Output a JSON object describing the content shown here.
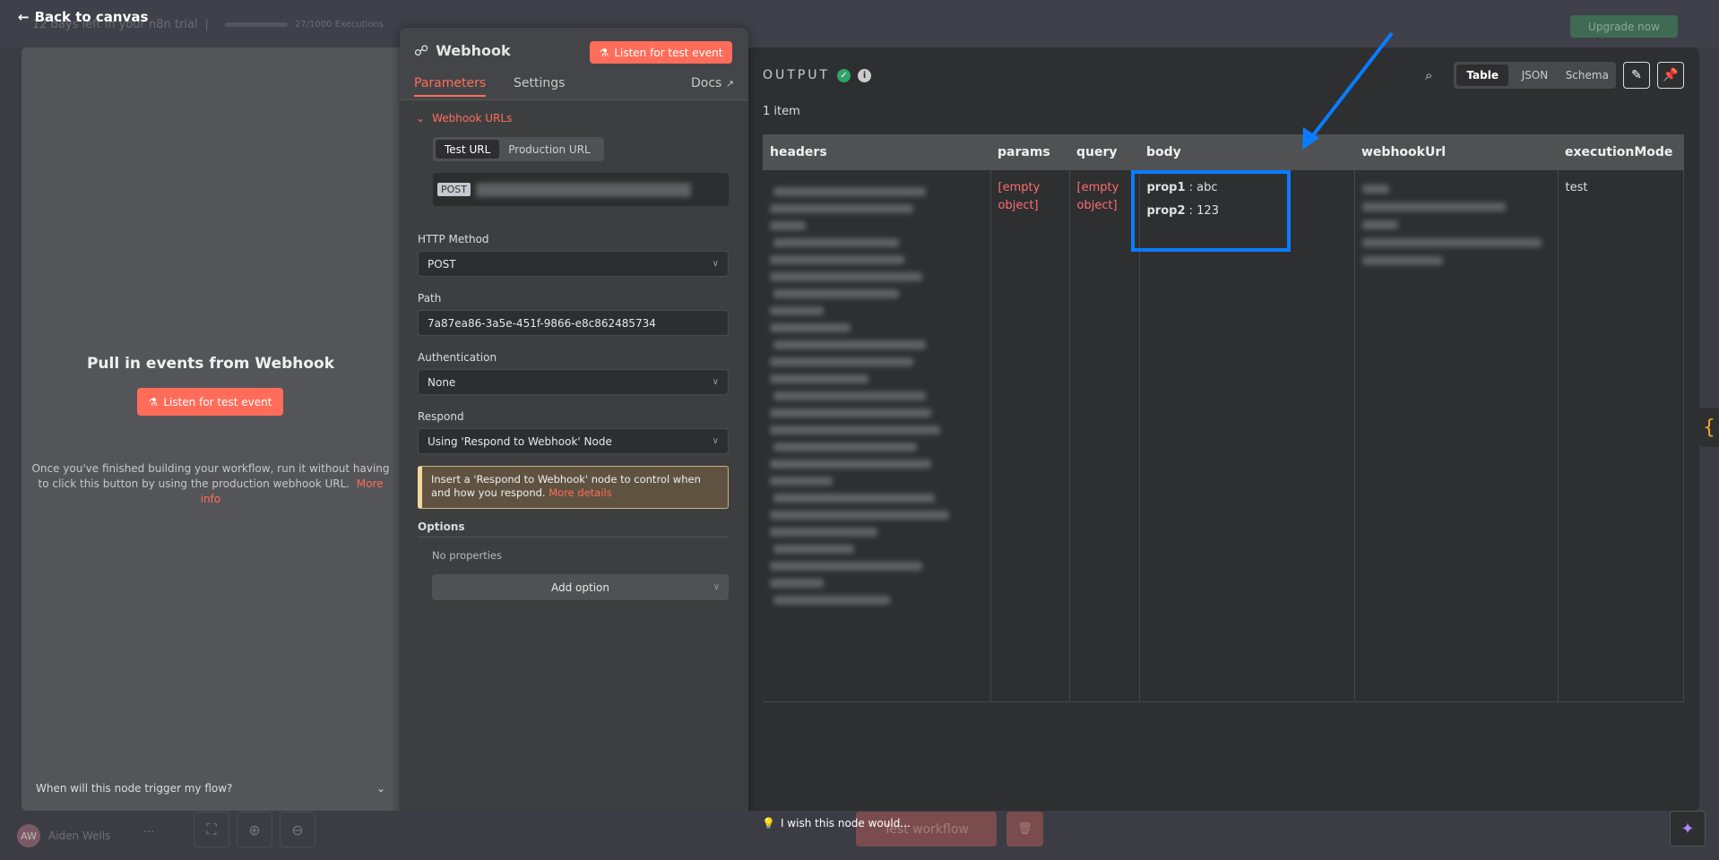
{
  "topbar": {
    "back_label": "Back to canvas",
    "trial_text": "12 days left in your n8n trial",
    "executions": "27/1000 Executions",
    "upgrade_label": "Upgrade now"
  },
  "left_panel": {
    "title": "Pull in events from Webhook",
    "listen_label": "Listen for test event",
    "description": "Once you've finished building your workflow, run it without having to click this button by using the production webhook URL.",
    "more_info": "More info",
    "faq": "When will this node trigger my flow?"
  },
  "params_panel": {
    "node_name": "Webhook",
    "listen_label": "Listen for test event",
    "tabs": [
      "Parameters",
      "Settings"
    ],
    "active_tab": "Parameters",
    "docs_label": "Docs",
    "webhook_urls_label": "Webhook URLs",
    "url_tabs": [
      "Test URL",
      "Production URL"
    ],
    "active_url_tab": "Test URL",
    "url_method_badge": "POST",
    "fields": {
      "http_method": {
        "label": "HTTP Method",
        "value": "POST"
      },
      "path": {
        "label": "Path",
        "value": "7a87ea86-3a5e-451f-9866-e8c862485734"
      },
      "authentication": {
        "label": "Authentication",
        "value": "None"
      },
      "respond": {
        "label": "Respond",
        "value": "Using 'Respond to Webhook' Node"
      }
    },
    "notice": {
      "text": "Insert a 'Respond to Webhook' node to control when and how you respond.",
      "link": "More details"
    },
    "options": {
      "label": "Options",
      "empty": "No properties",
      "add_label": "Add option"
    }
  },
  "output_panel": {
    "title": "OUTPUT",
    "item_count": "1 item",
    "views": [
      "Table",
      "JSON",
      "Schema"
    ],
    "active_view": "Table",
    "columns": [
      "headers",
      "params",
      "query",
      "body",
      "webhookUrl",
      "executionMode"
    ],
    "row": {
      "params": "[empty object]",
      "query": "[empty object]",
      "body": [
        {
          "key": "prop1",
          "value": "abc"
        },
        {
          "key": "prop2",
          "value": "123"
        }
      ],
      "executionMode": "test"
    },
    "highlight_color": "#0a7cff"
  },
  "bottom": {
    "user_initials": "AW",
    "user_name": "Aiden Wells",
    "wish_text": "I wish this node would...",
    "test_workflow_label": "Test workflow"
  },
  "colors": {
    "accent": "#ff6d5a",
    "success": "#2fa36b",
    "annotation": "#0a7cff"
  }
}
